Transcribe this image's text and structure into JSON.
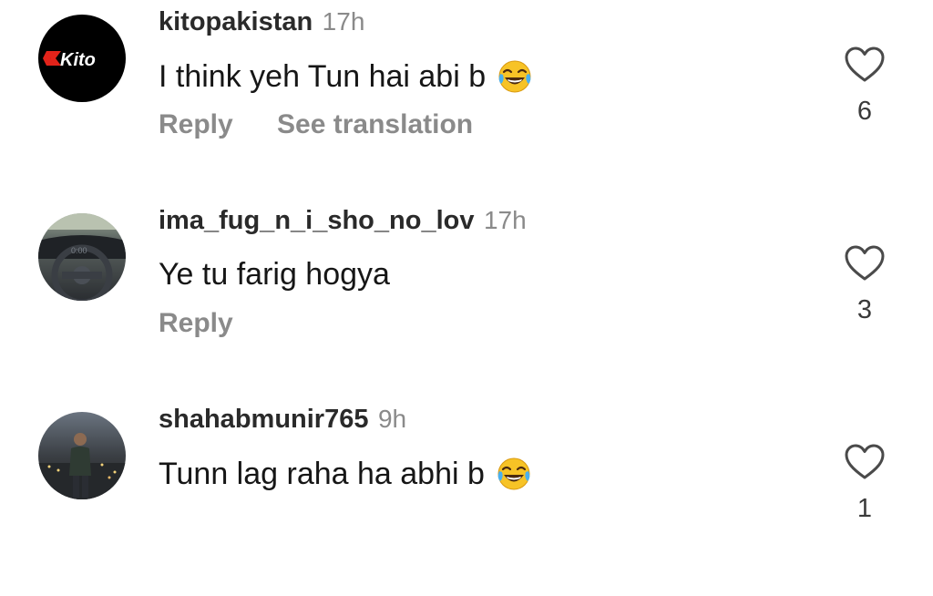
{
  "comments": [
    {
      "username": "kitopakistan",
      "time": "17h",
      "text": "I think yeh Tun hai abi b",
      "emoji": "face-with-tears-of-joy",
      "reply_label": "Reply",
      "translate_label": "See translation",
      "likes": "6",
      "avatar": {
        "type": "logo",
        "logo_text": "Kito",
        "bg": "#000000"
      }
    },
    {
      "username": "ima_fug_n_i_sho_no_lov",
      "time": "17h",
      "text": "Ye tu farig hogya",
      "reply_label": "Reply",
      "likes": "3",
      "avatar": {
        "type": "photo",
        "subject": "car-steering-wheel"
      }
    },
    {
      "username": "shahabmunir765",
      "time": "9h",
      "text": "Tunn lag raha ha abhi b",
      "emoji": "face-with-tears-of-joy",
      "likes": "1",
      "avatar": {
        "type": "photo",
        "subject": "person-standing-city-night"
      }
    }
  ],
  "colors": {
    "username": "#2a2a2a",
    "meta": "#8a8a8a",
    "text": "#161616"
  }
}
